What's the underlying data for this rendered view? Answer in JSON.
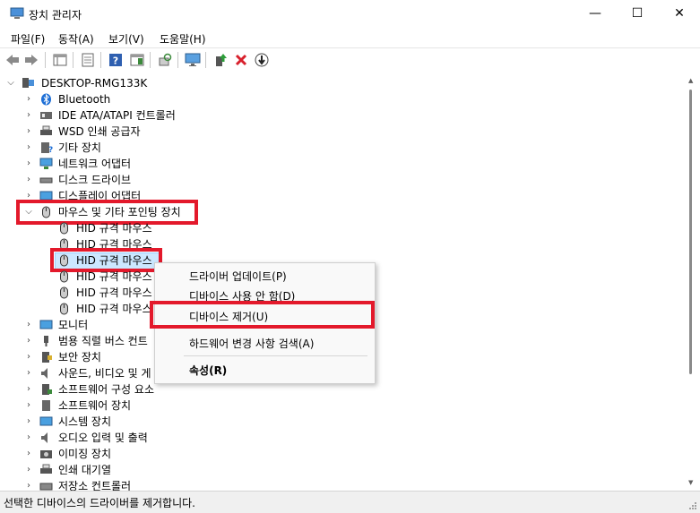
{
  "window": {
    "title": "장치 관리자",
    "minimize": "—",
    "maximize": "☐",
    "close": "✕"
  },
  "menu": [
    "파일(F)",
    "동작(A)",
    "보기(V)",
    "도움말(H)"
  ],
  "toolbar_icons": [
    "back-icon",
    "forward-icon",
    "show-hide-console-tree-icon",
    "properties-icon",
    "help-icon",
    "action-pane-icon",
    "scan-hardware-icon",
    "monitor-icon",
    "update-driver-icon",
    "uninstall-device-icon",
    "disable-device-icon"
  ],
  "tree": {
    "root": "DESKTOP-RMG133K",
    "categories": [
      {
        "label": "Bluetooth",
        "icon": "bluetooth-icon"
      },
      {
        "label": "IDE ATA/ATAPI 컨트롤러",
        "icon": "ide-controller-icon"
      },
      {
        "label": "WSD 인쇄 공급자",
        "icon": "printer-icon"
      },
      {
        "label": "기타 장치",
        "icon": "other-devices-icon"
      },
      {
        "label": "네트워크 어댑터",
        "icon": "network-adapter-icon"
      },
      {
        "label": "디스크 드라이브",
        "icon": "disk-drive-icon"
      },
      {
        "label": "디스플레이 어댑터",
        "icon": "display-adapter-icon"
      },
      {
        "label": "마우스 및 기타 포인팅 장치",
        "icon": "mouse-icon"
      }
    ],
    "mouse_children": [
      "HID 규격 마우스",
      "HID 규격 마우스",
      "HID 규격 마우스",
      "HID 규격 마우스",
      "HID 규격 마우스",
      "HID 규격 마우스"
    ],
    "after_categories": [
      {
        "label": "모니터",
        "icon": "monitor-icon"
      },
      {
        "label": "범용 직렬 버스 컨트",
        "icon": "usb-icon"
      },
      {
        "label": "보안 장치",
        "icon": "security-device-icon"
      },
      {
        "label": "사운드, 비디오 및 게",
        "icon": "sound-icon"
      },
      {
        "label": "소프트웨어 구성 요소",
        "icon": "software-component-icon"
      },
      {
        "label": "소프트웨어 장치",
        "icon": "software-device-icon"
      },
      {
        "label": "시스템 장치",
        "icon": "system-device-icon"
      },
      {
        "label": "오디오 입력 및 출력",
        "icon": "audio-io-icon"
      },
      {
        "label": "이미징 장치",
        "icon": "imaging-device-icon"
      },
      {
        "label": "인쇄 대기열",
        "icon": "print-queue-icon"
      },
      {
        "label": "저장소 컨트롤러",
        "icon": "storage-controller-icon"
      }
    ]
  },
  "context_menu": {
    "items": [
      "드라이버 업데이트(P)",
      "디바이스 사용 안 함(D)",
      "디바이스 제거(U)",
      "하드웨어 변경 사항 검색(A)",
      "속성(R)"
    ]
  },
  "status": "선택한 디바이스의 드라이버를 제거합니다.",
  "colors": {
    "highlight": "#e3192b",
    "selection": "#cce8ff",
    "accent": "#0078d4"
  }
}
